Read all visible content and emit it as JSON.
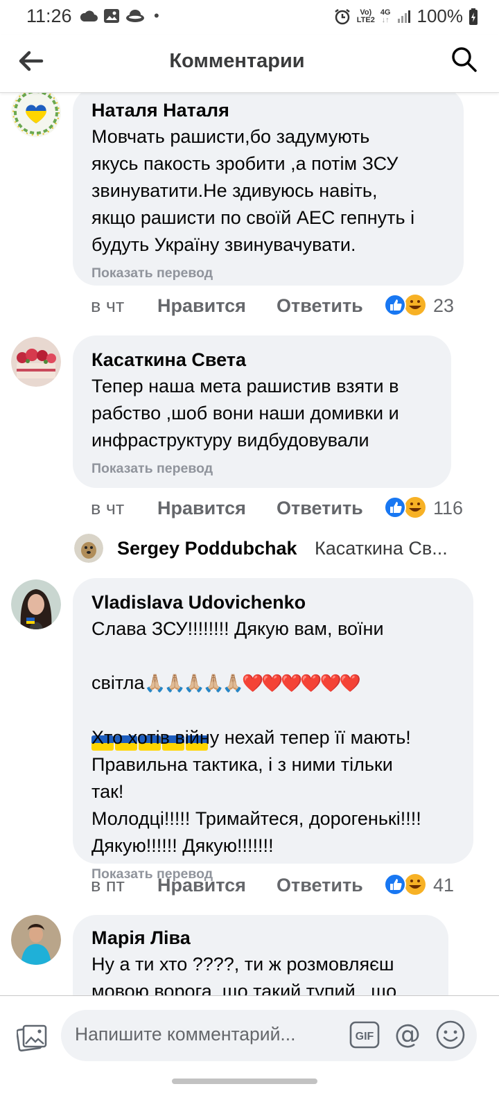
{
  "status_bar": {
    "time": "11:26",
    "dot": "•",
    "net_top": "Vo)",
    "net_bottom": "LTE2",
    "gen_top": "4G",
    "gen_bottom": "↓↑",
    "battery": "100%"
  },
  "header": {
    "title": "Комментарии",
    "back_icon": "arrow-left-icon",
    "search_icon": "search-icon"
  },
  "comments": [
    {
      "name": "Наталя Наталя",
      "text": "Мовчать рашисти,бо задумують\nякусь пакость зробити ,а потім ЗСУ\nзвинуватити.Не здивуюсь навіть,\nякщо рашисти по своїй АЕС гепнуть і\nбудуть Україну звинувачувати.",
      "translate": "Показать перевод",
      "time": "в чт",
      "like": "Нравится",
      "reply": "Ответить",
      "reactions": "23"
    },
    {
      "name": "Касаткина Света",
      "text": "Тепер наша мета рашистив взяти в\nрабство ,шоб вони наши домивки и\nинфраструктуру видбудовували",
      "translate": "Показать перевод",
      "time": "в чт",
      "like": "Нравится",
      "reply": "Ответить",
      "reactions": "116"
    },
    {
      "name": "Vladislava Udovichenko",
      "text_line1": "Слава ЗСУ!!!!!!!! Дякую вам, воїни",
      "text_line2": "світла",
      "text_line2_emoji": "🙏🏼🙏🏼🙏🏼🙏🏼🙏🏼❤️❤️❤️❤️❤️❤️",
      "text_rest": "Хто хотів війну нехай тепер її мають!\nПравильна тактика, і з ними тільки\nтак!\nМолодці!!!!! Тримайтеся, дорогенькі!!!!\nДякую!!!!!! Дякую!!!!!!!",
      "translate": "Показать перевод",
      "time": "в пт",
      "like": "Нравится",
      "reply": "Ответить",
      "reactions": "41"
    },
    {
      "name": "Марія Ліва",
      "text": "Ну а ти хто ????, ти ж розмовляєш\nмовою ворога, що такий тупий , що"
    }
  ],
  "reply_preview": {
    "name": "Sergey Poddubchak",
    "text": "Касаткина Св..."
  },
  "composer": {
    "placeholder": "Напишите комментарий...",
    "gif_label": "GIF",
    "at_label": "@"
  }
}
